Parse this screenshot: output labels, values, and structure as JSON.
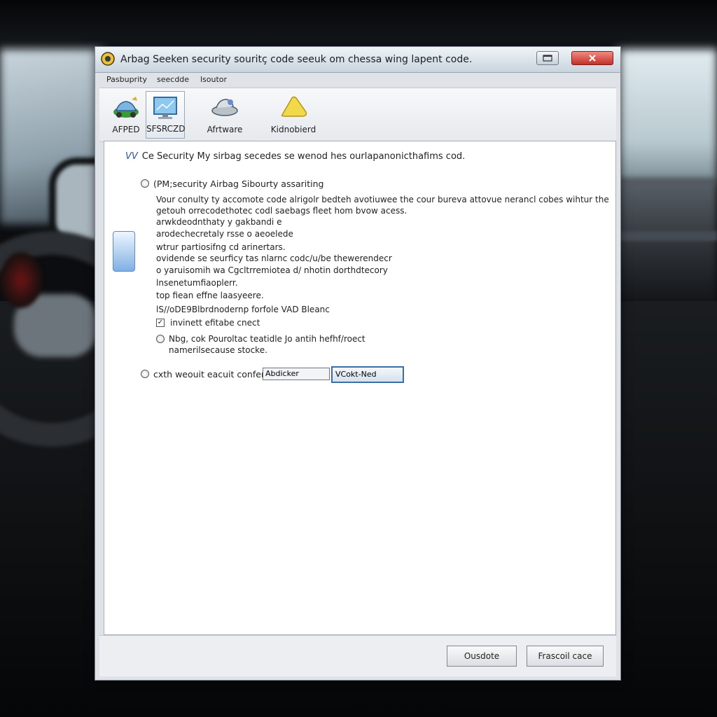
{
  "window": {
    "title": "Arbag Seeken security souritç code seeuk om chessa wing lapent code."
  },
  "menu": [
    "Pasbuprity",
    "seecdde",
    "lsoutor"
  ],
  "toolbar": [
    {
      "label": "AFPED",
      "icon": "car-icon"
    },
    {
      "label": "SFSRCZD",
      "icon": "monitor-icon"
    },
    {
      "label": "Afrtware",
      "icon": "car-part-icon"
    },
    {
      "label": "Kidnobierd",
      "icon": "warning-triangle-icon"
    }
  ],
  "content": {
    "header_mark": "VV",
    "header": "Ce Security My sirbag secedes se wenod hes ourlapanonicthafims cod.",
    "option1_label": "(PM;security Airbag Sibourty assariting",
    "description": [
      "Vour conulty ty accomote code alrigolr bedteh avotiuwee the cour bureva attovue nerancl cobes wihtur the",
      "getouh orrecodethotec codl saebags fleet hom bvow acess.",
      "arwkdeodnthaty y gakbandi e",
      "arodechecretaly rsse o aeoelede",
      "wtrur partiosifng cd arinertars.",
      "ovidende se seurficy tas nlarnc codc/u/be thewerendecr",
      "o yaruisomih wa Cgcltrremiotea d/ nhotin dorthdtecory",
      "lnsenetumfiaoplerr.",
      "top fiean effne laasyeere.",
      "lS//oDE9Blbrdnodernp forfole VAD Bleanc"
    ],
    "checkbox_label": "invinett efitabe cnect",
    "suboption_lines": [
      "Nbg, cok Pouroltac teatidle Jo antih hefhf/roect",
      "namerilsecause stocke."
    ],
    "option2_label": "cxth weouit eacuit confenke",
    "field_value": "Abdicker",
    "field_button": "VCokt-Ned"
  },
  "footer": {
    "button1": "Ousdote",
    "button2": "Frascoil cace"
  }
}
